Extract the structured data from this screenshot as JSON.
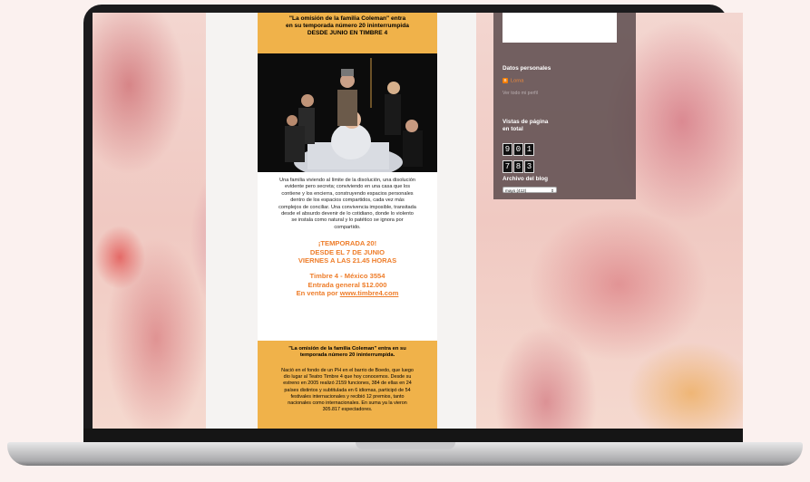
{
  "post": {
    "header_lines": [
      "\"La omisión de la familia Coleman\" entra",
      "en su temporada número 20 ininterrumpida",
      "DESDE JUNIO EN TIMBRE 4"
    ],
    "description_lines": [
      "Una familia viviendo al límite de la disolución, una disolución",
      "evidente pero secreta; conviviendo en una casa que los",
      "contiene y los encierra, construyendo espacios personales",
      "dentro de los espacios compartidos, cada vez más",
      "complejos de conciliar. Una convivencia imposible, transitada",
      "desde el absurdo devenir de lo cotidiano, donde lo violento",
      "se instala como natural y lo patético se ignora por",
      "compartido."
    ],
    "season_lines": [
      "¡TEMPORADA 20!",
      "DESDE EL 7 DE JUNIO",
      "VIERNES A LAS 21.45 HORAS"
    ],
    "venue_line1": "Timbre 4 - México 3554",
    "venue_line2": "Entrada general $12.000",
    "sale_prefix": "En venta por ",
    "sale_link": "www.timbre4.com",
    "box_title_lines": [
      "\"La omisión de la familia Coleman\" entra en su",
      "temporada número 20 ininterrumpida."
    ],
    "history_lines": [
      "Nació en el fondo de un PH en el barrio de Boedo, que luego",
      "dio lugar al Teatro Timbre 4 que hoy conocemos. Desde su",
      "estreno en 2005 realizó 2159 funciones, 384 de ellas en 24",
      "países distintos y subtitulada en 6 idiomas, participó de 54",
      "festivales internacionales y recibió 12 premios, tanto",
      "nacionales como internacionales. En suma ya la vieron",
      "305.817 espectadores."
    ]
  },
  "sidebar": {
    "profile_heading": "Datos personales",
    "profile_name": "Lorna",
    "profile_link": "Ver todo mi perfil",
    "views_heading_line1": "Vistas de página",
    "views_heading_line2": "en total",
    "counter_digits": [
      "9",
      "0",
      "1",
      "7",
      "8",
      "3"
    ],
    "archive_heading": "Archivo del blog",
    "archive_selected": "mayo (412)"
  },
  "colors": {
    "header_bg": "#f0b24a",
    "accent_orange": "#ee7d2a",
    "sidebar_bg": "#554648"
  },
  "icons": {
    "blogger": "blogger-icon",
    "dropdown": "chevron-updown-icon"
  }
}
